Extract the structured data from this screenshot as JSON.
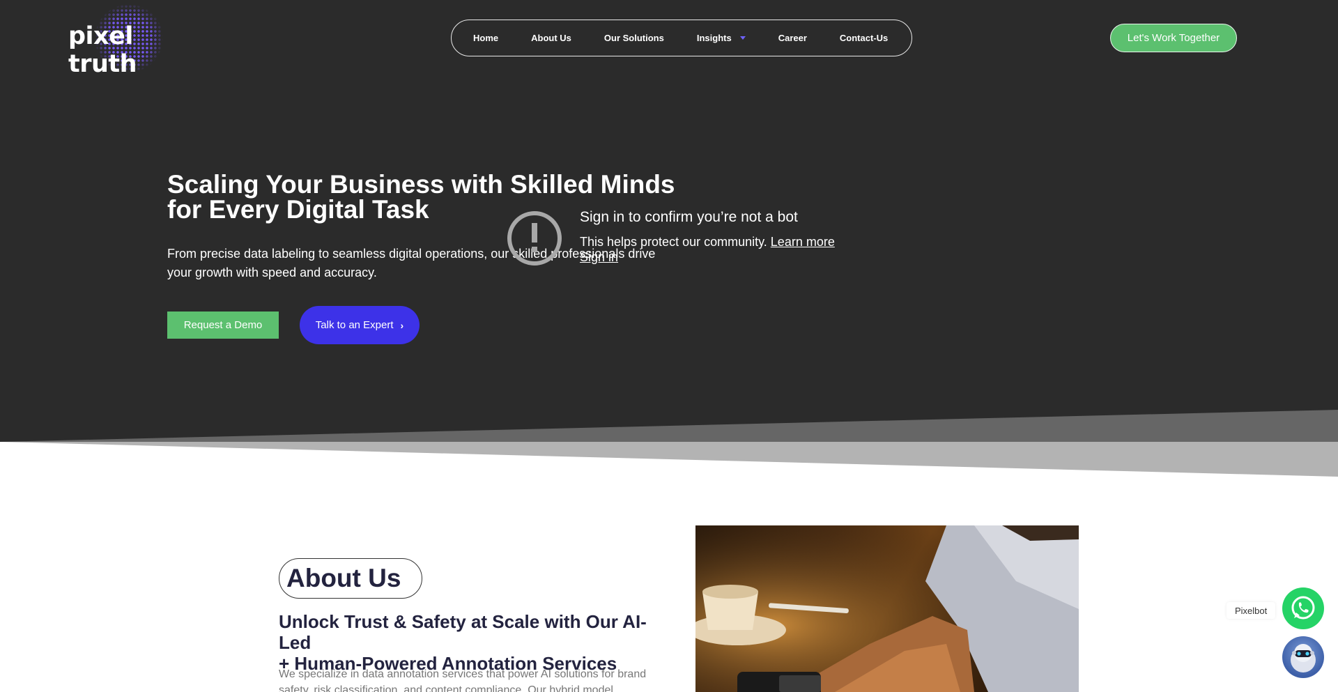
{
  "brand": {
    "logo_text": "pixel truth"
  },
  "nav": {
    "items": [
      {
        "label": "Home"
      },
      {
        "label": "About Us"
      },
      {
        "label": "Our Solutions"
      },
      {
        "label": "Insights",
        "has_dropdown": true
      },
      {
        "label": "Career"
      },
      {
        "label": "Contact-Us"
      }
    ],
    "cta_label": "Let's Work Together"
  },
  "hero": {
    "title_line1": "Scaling Your Business with Skilled Minds",
    "title_line2": "for Every Digital Task",
    "subtitle_line1": "From precise data labeling to seamless digital operations, our skilled professionals drive",
    "subtitle_line2": "your growth with speed and accuracy.",
    "primary_button": "Request a Demo",
    "secondary_button": "Talk to an Expert"
  },
  "bot_check": {
    "title": "Sign in to confirm you’re not a bot",
    "text": "This helps protect our community.",
    "learn_more": "Learn more",
    "sign_in": "Sign in"
  },
  "about": {
    "pill_label": "About Us",
    "heading_line1": "Unlock Trust & Safety at Scale with Our AI-Led",
    "heading_line2": "+ Human-Powered Annotation Services",
    "body_line1": "We specialize in data annotation services that power AI solutions for brand",
    "body_line2": "safety, risk classification, and content compliance. Our hybrid model"
  },
  "widgets": {
    "pixelbot_label": "Pixelbot"
  },
  "colors": {
    "hero_bg": "#2b2b2b",
    "accent_green": "#5cc06f",
    "accent_blue": "#3d32e8",
    "whatsapp_green": "#25d366",
    "heading_navy": "#23233f"
  }
}
